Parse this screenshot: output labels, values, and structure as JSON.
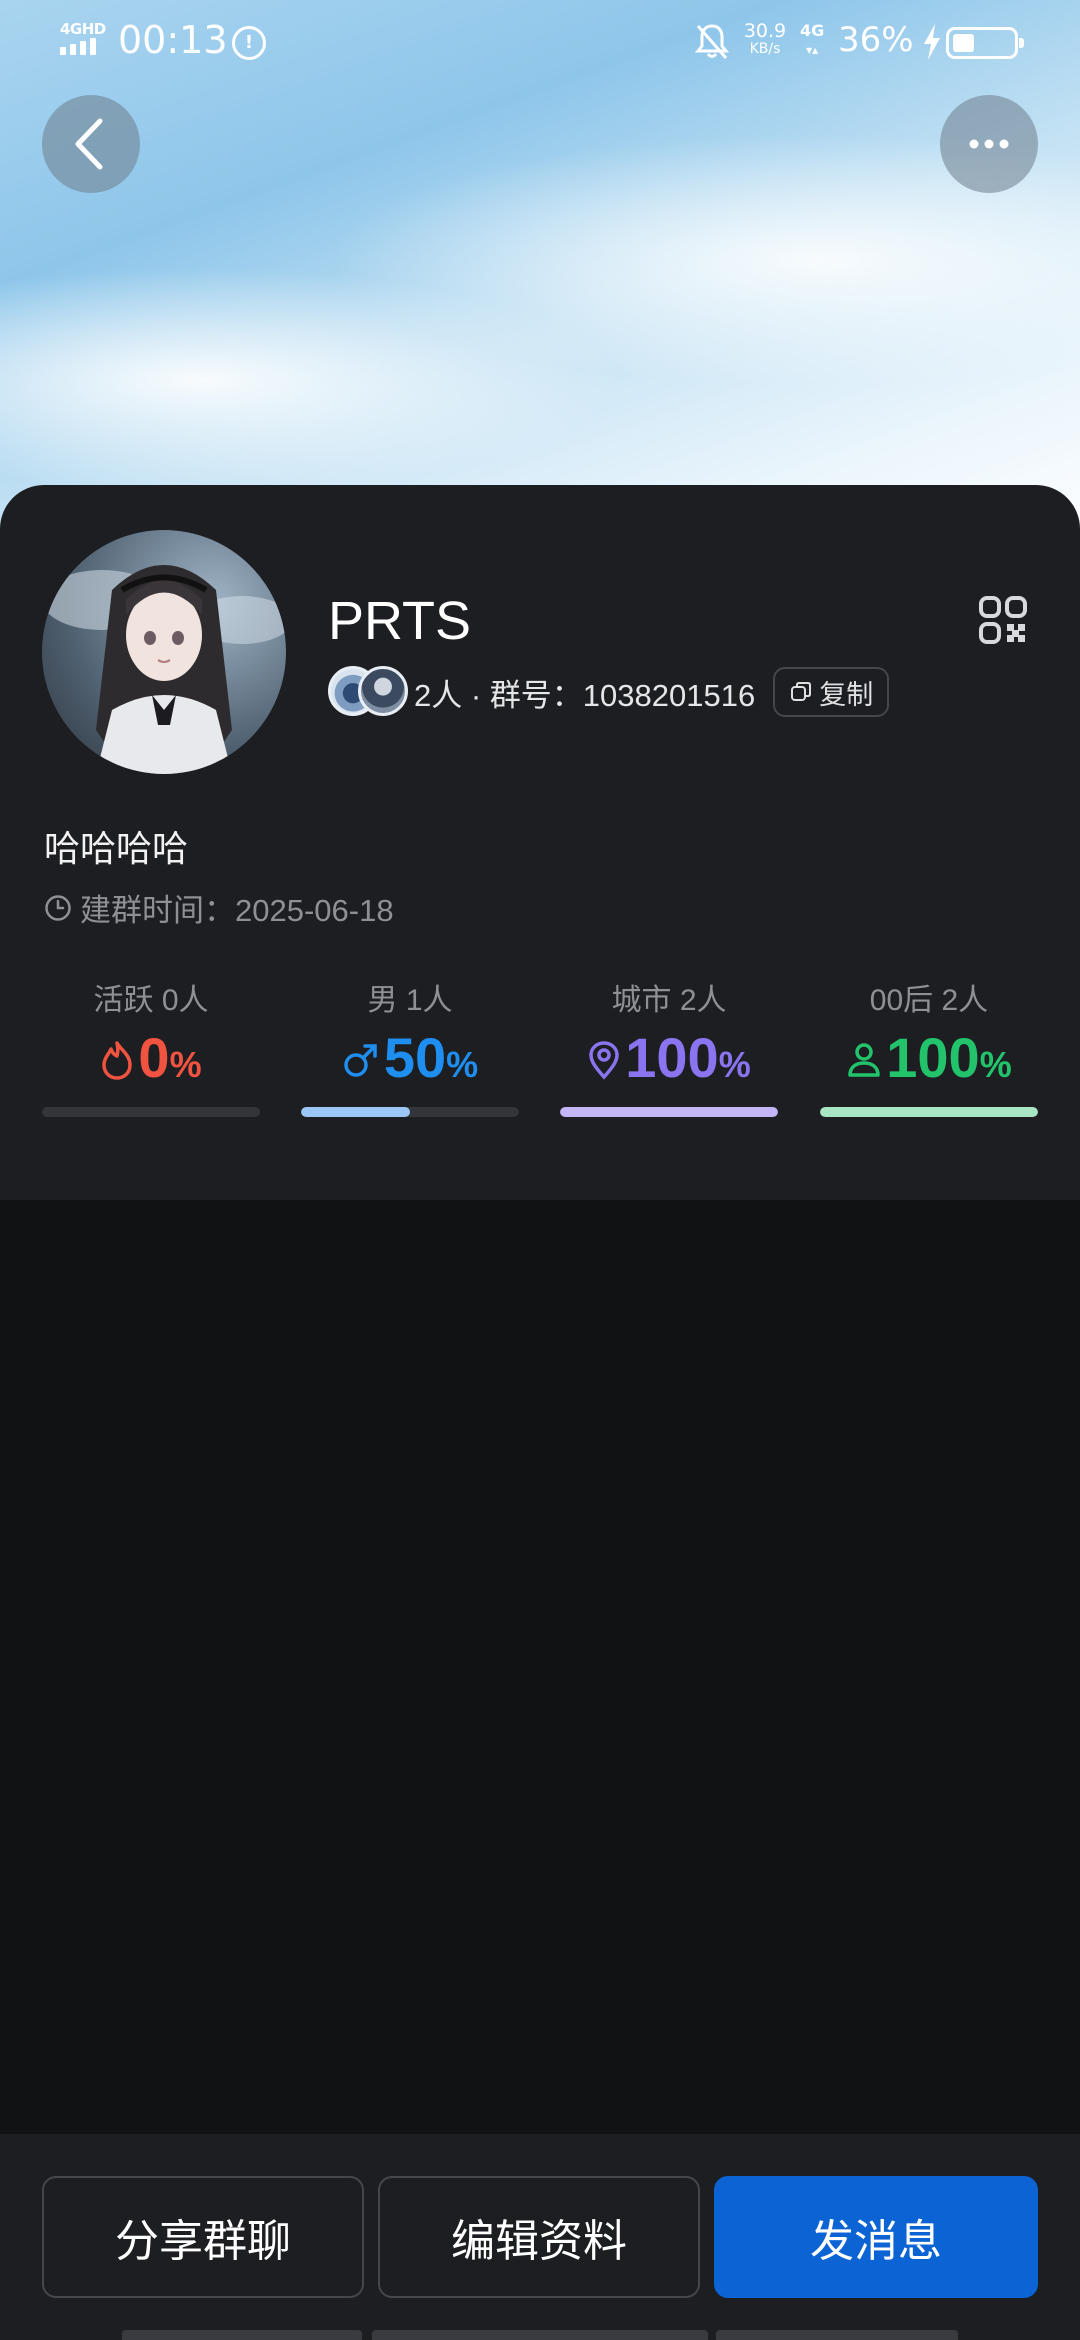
{
  "status_bar": {
    "network_label": "4GHD",
    "time": "00:13",
    "speed_value": "30.9",
    "speed_unit": "KB/s",
    "network_type": "4G",
    "battery_percent_text": "36%",
    "battery_level": 0.36
  },
  "group": {
    "name": "PRTS",
    "member_summary": "2人 · 群号：1038201516",
    "copy_label": "复制",
    "intro": "哈哈哈哈",
    "created_label": "建群时间：2025-06-18"
  },
  "stats": [
    {
      "label": "活跃 0人",
      "value": "0",
      "unit": "%",
      "level": 0.0,
      "color": "#f0533f",
      "icon": "flame-icon",
      "bar_color": "#3a3b40"
    },
    {
      "label": "男 1人",
      "value": "50",
      "unit": "%",
      "level": 0.5,
      "color": "#1e8ef0",
      "icon": "male-icon",
      "bar_color": "#9cc6f5"
    },
    {
      "label": "城市 2人",
      "value": "100",
      "unit": "%",
      "level": 1.0,
      "color": "#8b74f0",
      "icon": "location-pin-icon",
      "bar_color": "#c4b5f7"
    },
    {
      "label": "00后 2人",
      "value": "100",
      "unit": "%",
      "level": 1.0,
      "color": "#22c36b",
      "icon": "person-icon",
      "bar_color": "#a6e6c2"
    }
  ],
  "actions": {
    "share_label": "分享群聊",
    "edit_label": "编辑资料",
    "send_label": "发消息"
  },
  "colors": {
    "primary": "#0c63d4",
    "card_bg": "#1d1e22",
    "page_bg": "#111214"
  }
}
